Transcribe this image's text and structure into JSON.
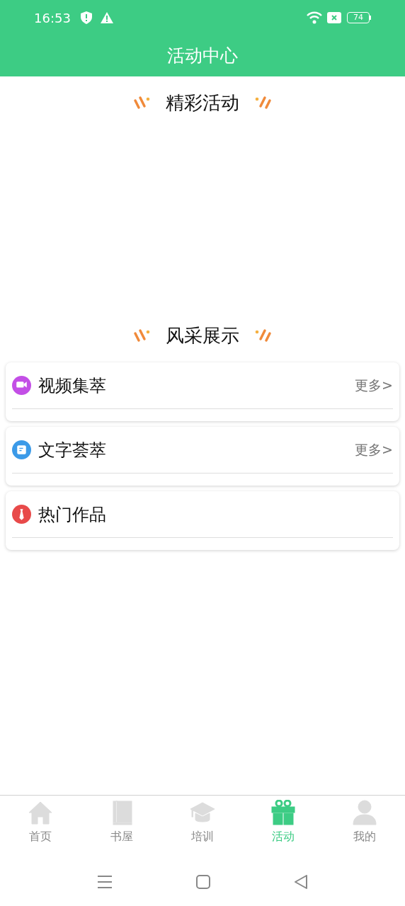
{
  "status_bar": {
    "time": "16:53",
    "battery": "74"
  },
  "header": {
    "title": "活动中心"
  },
  "sections": [
    {
      "title": "精彩活动"
    },
    {
      "title": "风采展示"
    }
  ],
  "cards": [
    {
      "title": "视频集萃",
      "more": "更多>",
      "color": "#c34fe6"
    },
    {
      "title": "文字荟萃",
      "more": "更多>",
      "color": "#3b9ae8"
    },
    {
      "title": "热门作品",
      "color": "#e84a4a"
    }
  ],
  "tabs": [
    {
      "label": "首页",
      "selected": false
    },
    {
      "label": "书屋",
      "selected": false
    },
    {
      "label": "培训",
      "selected": false
    },
    {
      "label": "活动",
      "selected": true
    },
    {
      "label": "我的",
      "selected": false
    }
  ]
}
